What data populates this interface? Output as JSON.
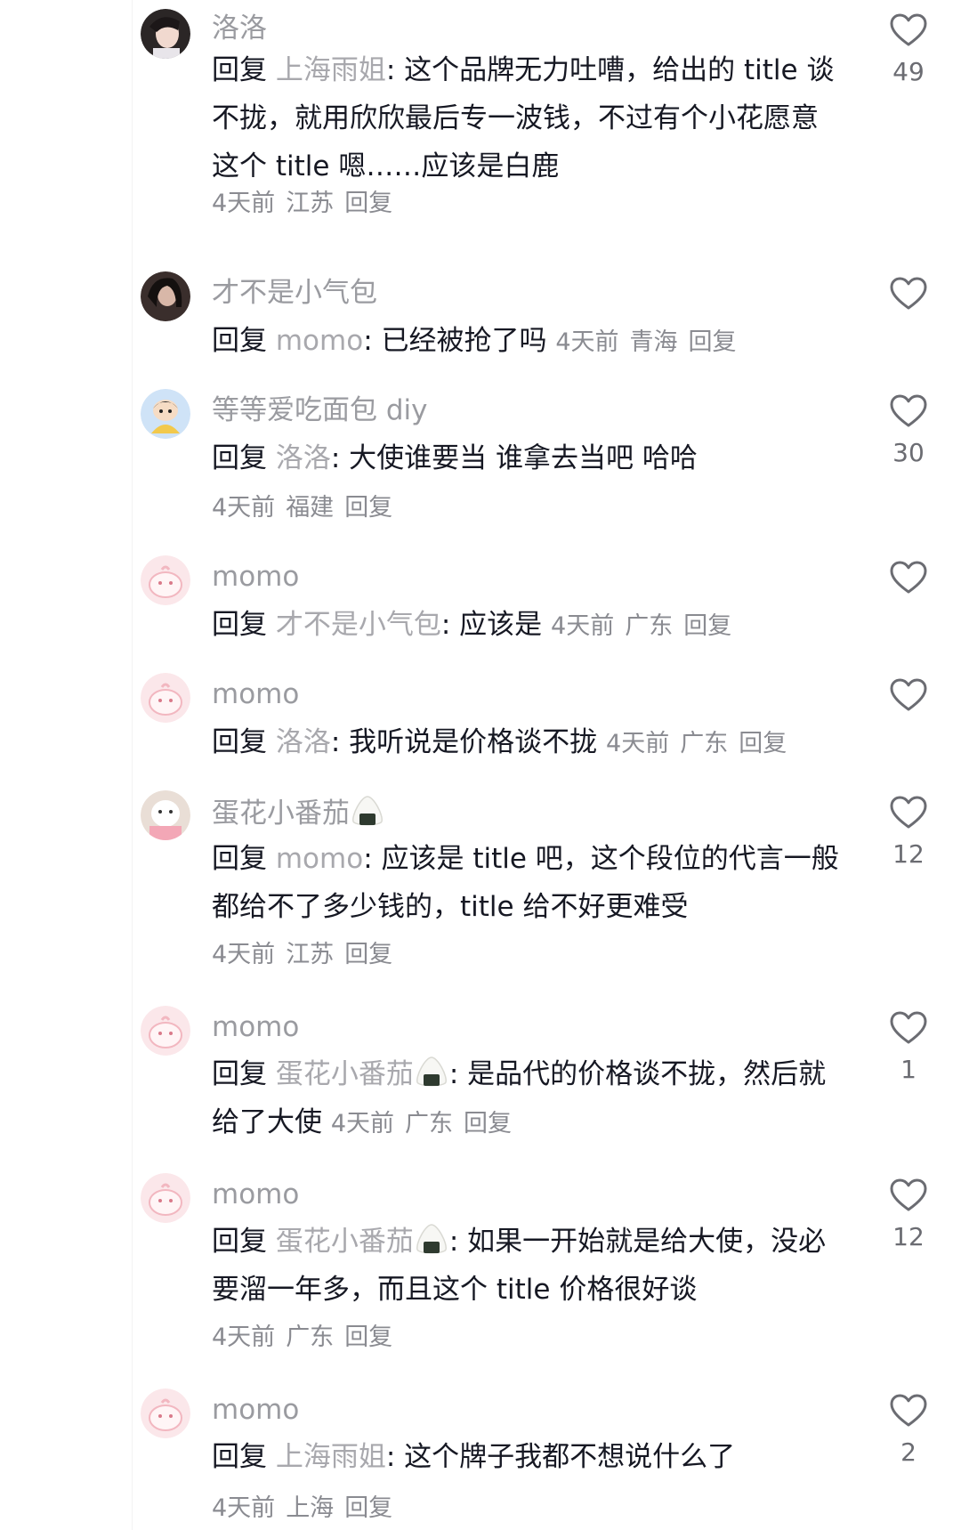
{
  "comments": [
    {
      "username": "洛洛",
      "reply_word": "回复",
      "mention": "上海雨姐",
      "text": ": 这个品牌无力吐嘈，给出的 title 谈不拢，就用欣欣最后专一波钱，不过有个小花愿意这个 title 嗯……应该是白鹿",
      "time": "4天前",
      "location": "江苏",
      "reply_label": "回复",
      "likes": "49"
    },
    {
      "username": "才不是小气包",
      "reply_word": "回复",
      "mention": "momo",
      "text": ": 已经被抢了吗",
      "time": "4天前",
      "location": "青海",
      "reply_label": "回复",
      "likes": ""
    },
    {
      "username": "等等爱吃面包 diy",
      "reply_word": "回复",
      "mention": "洛洛",
      "text": ": 大使谁要当 谁拿去当吧 哈哈",
      "time": "4天前",
      "location": "福建",
      "reply_label": "回复",
      "likes": "30"
    },
    {
      "username": "momo",
      "reply_word": "回复",
      "mention": "才不是小气包",
      "text": ": 应该是",
      "time": "4天前",
      "location": "广东",
      "reply_label": "回复",
      "likes": ""
    },
    {
      "username": "momo",
      "reply_word": "回复",
      "mention": "洛洛",
      "text": ": 我听说是价格谈不拢",
      "time": "4天前",
      "location": "广东",
      "reply_label": "回复",
      "likes": ""
    },
    {
      "username": "蛋花小番茄",
      "reply_word": "回复",
      "mention": "momo",
      "text": ": 应该是 title 吧，这个段位的代言一般都给不了多少钱的，title 给不好更难受",
      "time": "4天前",
      "location": "江苏",
      "reply_label": "回复",
      "likes": "12"
    },
    {
      "username": "momo",
      "reply_word": "回复",
      "mention": "蛋花小番茄",
      "text": ": 是品代的价格谈不拢，然后就给了大使",
      "time": "4天前",
      "location": "广东",
      "reply_label": "回复",
      "likes": "1"
    },
    {
      "username": "momo",
      "reply_word": "回复",
      "mention": "蛋花小番茄",
      "text": ": 如果一开始就是给大使，没必要溜一年多，而且这个 title 价格很好谈",
      "time": "4天前",
      "location": "广东",
      "reply_label": "回复",
      "likes": "12"
    },
    {
      "username": "momo",
      "reply_word": "回复",
      "mention": "上海雨姐",
      "text": ": 这个牌子我都不想说什么了",
      "time": "4天前",
      "location": "上海",
      "reply_label": "回复",
      "likes": "2"
    }
  ],
  "colors": {
    "text": "#161823",
    "secondary": "#9a9ba0",
    "meta": "#8a8b91",
    "heart_stroke": "#6b6c72"
  },
  "icons": {
    "like": "heart-outline-icon",
    "onigiri": "onigiri-emoji-icon"
  }
}
